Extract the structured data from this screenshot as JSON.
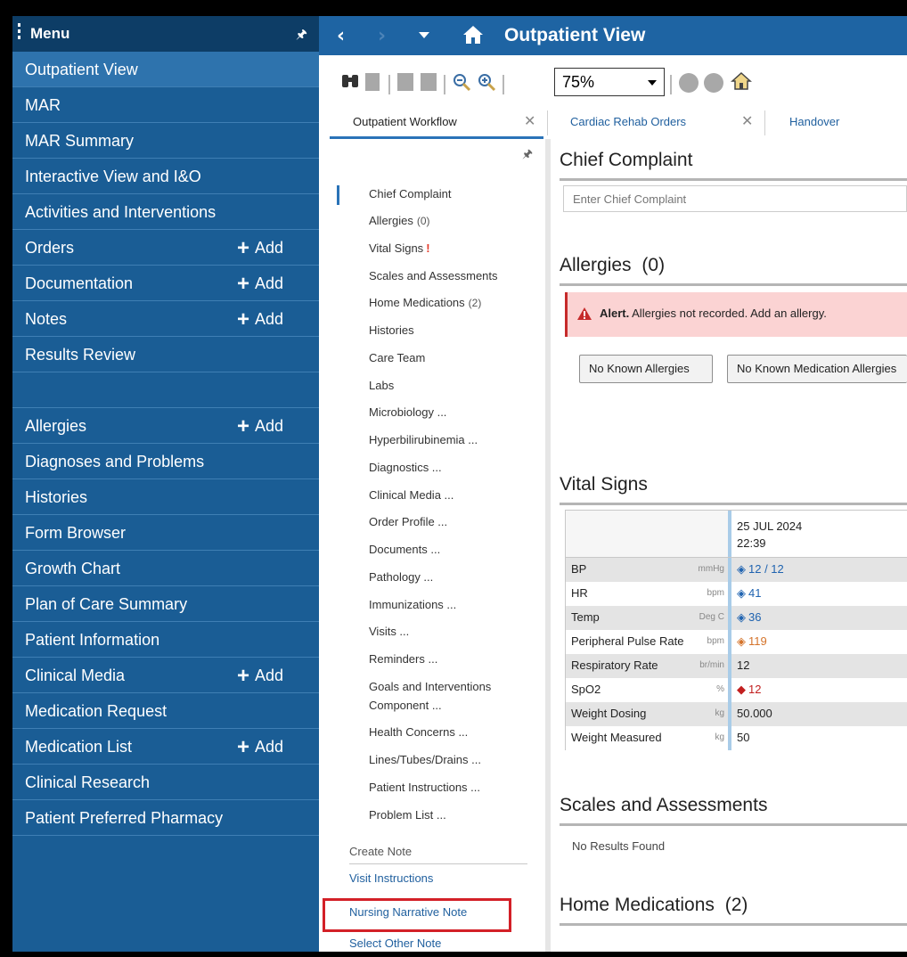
{
  "sidebar": {
    "title": "Menu",
    "pin_icon": "pin-icon",
    "items": [
      {
        "label": "Outpatient View",
        "active": true
      },
      {
        "label": "MAR"
      },
      {
        "label": "MAR Summary"
      },
      {
        "label": "Interactive View and I&O"
      },
      {
        "label": "Activities and Interventions"
      },
      {
        "label": "Orders",
        "add": "Add"
      },
      {
        "label": "Documentation",
        "add": "Add"
      },
      {
        "label": "Notes",
        "add": "Add"
      },
      {
        "label": "Results Review"
      },
      {
        "label": ""
      },
      {
        "label": "Allergies",
        "add": "Add"
      },
      {
        "label": "Diagnoses and Problems"
      },
      {
        "label": "Histories"
      },
      {
        "label": "Form Browser"
      },
      {
        "label": "Growth Chart"
      },
      {
        "label": "Plan of Care Summary"
      },
      {
        "label": "Patient Information"
      },
      {
        "label": "Clinical Media",
        "add": "Add"
      },
      {
        "label": "Medication Request"
      },
      {
        "label": "Medication List",
        "add": "Add"
      },
      {
        "label": "Clinical Research"
      },
      {
        "label": "Patient Preferred Pharmacy"
      }
    ]
  },
  "header": {
    "title": "Outpatient View"
  },
  "toolbar": {
    "zoom": "75%"
  },
  "tabs": [
    {
      "label": "Outpatient Workflow"
    },
    {
      "label": "Cardiac Rehab Orders"
    },
    {
      "label": "Handover"
    }
  ],
  "workflow": {
    "items": [
      {
        "label": "Chief Complaint"
      },
      {
        "label": "Allergies",
        "count": "(0)"
      },
      {
        "label": "Vital Signs",
        "flag": "!"
      },
      {
        "label": "Scales and Assessments"
      },
      {
        "label": "Home Medications",
        "count": "(2)"
      },
      {
        "label": "Histories"
      },
      {
        "label": "Care Team"
      },
      {
        "label": "Labs"
      },
      {
        "label": "Microbiology ..."
      },
      {
        "label": "Hyperbilirubinemia ..."
      },
      {
        "label": "Diagnostics ..."
      },
      {
        "label": "Clinical Media ..."
      },
      {
        "label": "Order Profile ..."
      },
      {
        "label": "Documents ..."
      },
      {
        "label": "Pathology ..."
      },
      {
        "label": "Immunizations ..."
      },
      {
        "label": "Visits ..."
      },
      {
        "label": "Reminders ..."
      },
      {
        "label": "Goals and Interventions"
      },
      {
        "label": "Component ..."
      },
      {
        "label": "Health Concerns ..."
      },
      {
        "label": "Lines/Tubes/Drains ..."
      },
      {
        "label": "Patient Instructions ..."
      },
      {
        "label": "Problem List ..."
      }
    ],
    "create_note": "Create Note",
    "notes": [
      "Visit Instructions",
      "Nursing Narrative Note",
      "Select Other Note"
    ]
  },
  "main": {
    "chief_complaint": {
      "title": "Chief Complaint",
      "placeholder": "Enter Chief Complaint"
    },
    "allergies": {
      "title": "Allergies",
      "count": "(0)",
      "alert_bold": "Alert.",
      "alert_text": "Allergies not recorded. Add an allergy.",
      "btn_nka": "No Known Allergies",
      "btn_nkma": "No Known Medication Allergies"
    },
    "vitals": {
      "title": "Vital Signs",
      "date": "25 JUL 2024",
      "time": "22:39",
      "rows": [
        {
          "name": "BP",
          "unit": "mmHg",
          "value": "12 / 12",
          "style": "blue",
          "icon": "info-diamond-icon"
        },
        {
          "name": "HR",
          "unit": "bpm",
          "value": "41",
          "style": "blue",
          "icon": "info-diamond-icon"
        },
        {
          "name": "Temp",
          "unit": "Deg C",
          "value": "36",
          "style": "blue",
          "icon": "info-diamond-icon"
        },
        {
          "name": "Peripheral Pulse Rate",
          "unit": "bpm",
          "value": "119",
          "style": "orange",
          "icon": "info-diamond-icon"
        },
        {
          "name": "Respiratory Rate",
          "unit": "br/min",
          "value": "12",
          "style": "plain"
        },
        {
          "name": "SpO2",
          "unit": "%",
          "value": "12",
          "style": "red",
          "icon": "critical-diamond-icon"
        },
        {
          "name": "Weight Dosing",
          "unit": "kg",
          "value": "50.000",
          "style": "plain"
        },
        {
          "name": "Weight Measured",
          "unit": "kg",
          "value": "50",
          "style": "plain"
        }
      ]
    },
    "scales": {
      "title": "Scales and Assessments",
      "empty": "No Results Found"
    },
    "home_meds": {
      "title": "Home Medications",
      "count": "(2)"
    }
  }
}
